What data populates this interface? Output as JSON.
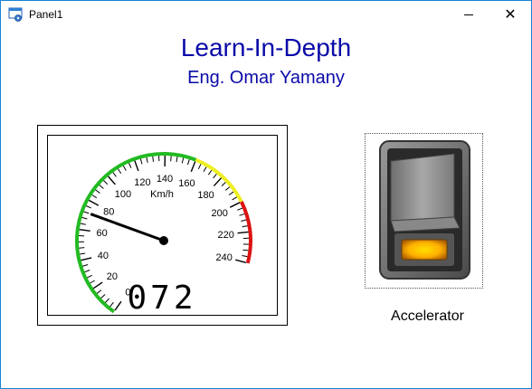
{
  "window": {
    "title": "Panel1",
    "minimize_glyph": "—",
    "close_glyph": "✕"
  },
  "header": {
    "title": "Learn-In-Depth",
    "subtitle": "Eng. Omar Yamany"
  },
  "gauge": {
    "unit_label": "Km/h",
    "min": 0,
    "max": 240,
    "major_ticks": [
      0,
      20,
      40,
      60,
      80,
      100,
      120,
      140,
      160,
      180,
      200,
      220,
      240
    ],
    "current_value": 72,
    "digital_readout": "072",
    "zones": [
      {
        "from": 0,
        "to": 160,
        "color": "#22bb22"
      },
      {
        "from": 160,
        "to": 200,
        "color": "#eeee22"
      },
      {
        "from": 200,
        "to": 240,
        "color": "#dd1111"
      }
    ],
    "needle_color": "#000000"
  },
  "switch": {
    "label": "Accelerator",
    "lamp_color": "#ffb000"
  }
}
